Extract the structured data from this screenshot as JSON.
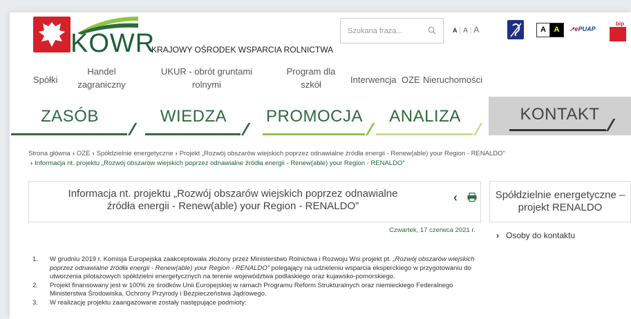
{
  "header": {
    "logo_text": "KOWR",
    "org_name": "KRAJOWY OŚRODEK WSPARCIA ROLNICTWA",
    "search_placeholder": "Szukana fraza...",
    "font_sizes": [
      "A",
      "A",
      "A"
    ],
    "contrast": [
      "A",
      "A"
    ],
    "epuap_prefix": "e",
    "epuap_label": "PUAP",
    "bip_label": "bip"
  },
  "topnav": [
    {
      "label": "Spółki"
    },
    {
      "label": "Handel zagraniczny"
    },
    {
      "label": "UKUR - obrót gruntami rolnymi"
    },
    {
      "label": "Program dla szkół"
    },
    {
      "label": "Interwencja"
    },
    {
      "label": "OZE"
    },
    {
      "label": "Nieruchomości"
    }
  ],
  "tabs": [
    {
      "label": "ZASÓB"
    },
    {
      "label": "WIEDZA"
    },
    {
      "label": "PROMOCJA"
    },
    {
      "label": "ANALIZA"
    },
    {
      "label": "KONTAKT"
    }
  ],
  "breadcrumb": [
    "Strona główna",
    "OZE",
    "Spółdzielnie energetyczne",
    "Projekt „Rozwój obszarów wiejskich poprzez odnawialne źródła energii - Renew(able) your Region - RENALDO”",
    "Informacja nt. projektu „Rozwój obszarów wiejskich poprzez odnawialne źródła energii - Renew(able) your Region - RENALDO”"
  ],
  "article": {
    "title": "Informacja nt. projektu „Rozwój obszarów wiejskich poprzez odnawialne źródła energii - Renew(able) your Region - RENALDO”",
    "date": "Czwartek, 17 czerwca 2021 r.",
    "items": [
      {
        "num": "1.",
        "part1": "W grudniu 2019 r. Komisja Europejska zaakceptowała złożony przez Ministerstwo Rolnictwa i Rozwoju Wsi projekt pt. ",
        "italic": "„Rozwój obszarów wiejskich poprzez odnawialne źródła energii - Renew(able) your Region - RENALDO”",
        "part2": " polegający na udzieleniu wsparcia eksperckiego w przygotowaniu do utworzenia pilotażowych spółdzielni energetycznych na terenie województwa podlaskiego oraz kujawsko-pomorskiego."
      },
      {
        "num": "2.",
        "part1": "Projekt finansowany jest w 100% ze środków Unii Europejskiej w ramach Programu Reform Strukturalnych oraz niemieckiego Federalnego Ministerstwa Środowiska, Ochrony Przyrody i Bezpieczeństwa Jądrowego.",
        "italic": "",
        "part2": ""
      },
      {
        "num": "3.",
        "part1": "W realizację projektu zaangażowane zostały następujące podmioty:",
        "italic": "",
        "part2": ""
      }
    ]
  },
  "sidebar": {
    "title": "Spółdzielnie energetyczne – projekt RENALDO",
    "links": [
      {
        "label": "Osoby do kontaktu"
      }
    ]
  },
  "colors": {
    "brand_green": "#2d6a3e",
    "light_green": "#8dc63f",
    "kontakt_bg": "#d0d0d0"
  }
}
